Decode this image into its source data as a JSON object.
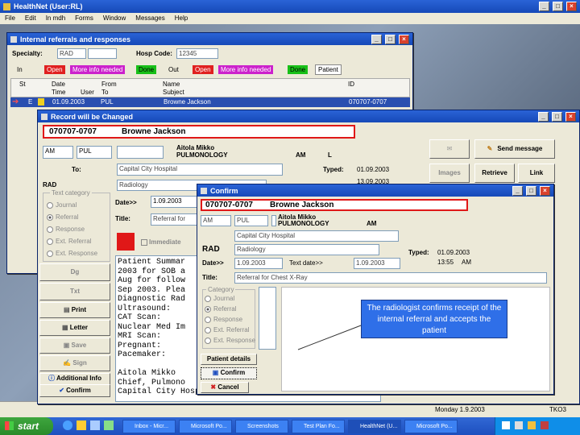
{
  "app": {
    "title": "HealthNet (User:RL)",
    "menu": [
      "File",
      "Edit",
      "In mdh",
      "Forms",
      "Window",
      "Messages",
      "Help"
    ]
  },
  "referrals": {
    "title": "Internal referrals and responses",
    "specialty_label": "Specialty:",
    "specialty_value": "RAD",
    "hosp_label": "Hosp Code:",
    "hosp_value": "12345",
    "in_label": "In",
    "out_label": "Out",
    "tags": [
      "Open",
      "More info needed",
      "Done"
    ],
    "patient_tab": "Patient",
    "headers": {
      "st": "St",
      "date": "Date",
      "time": "Time",
      "user": "User",
      "from": "From",
      "to": "To",
      "name": "Name",
      "subject": "Subject",
      "id": "ID"
    },
    "row": {
      "st": "E",
      "date": "01.09.2003",
      "from": "PUL",
      "name": "Browne Jackson",
      "id": "070707-0707"
    }
  },
  "record": {
    "title": "Record will be Changed",
    "patient_id": "070707-0707",
    "patient_name": "Browne Jackson",
    "am": "AM",
    "pul": "PUL",
    "doctor": "Aitola Mikko",
    "dept": "PULMONOLOGY",
    "am2": "AM",
    "l": "L",
    "to_label": "To:",
    "to_value": "Capital City Hospital",
    "rad": "RAD",
    "radiology": "Radiology",
    "typed_label": "Typed:",
    "typed_value": "01.09.2003",
    "typed_value2": "13.09.2003",
    "category_label": "Text category",
    "categories": [
      "Journal",
      "Referral",
      "Response",
      "Ext. Referral",
      "Ext. Response"
    ],
    "date_label": "Date>>",
    "date_value": "1.09.2003",
    "title_label": "Title:",
    "title_value": "Referral for",
    "immediate": "Immediate",
    "send_message": "Send message",
    "images": "Images",
    "retrieve": "Retrieve",
    "link": "Link",
    "side_buttons": [
      "Dg",
      "Txt",
      "Print",
      "Letter",
      "Save",
      "Sign",
      "Additional Info",
      "Confirm"
    ],
    "body_text": "Patient Summar\n2003 for SOB a\nAug for follow\nSep 2003. Plea\nDiagnostic Rad\nUltrasound:\nCAT Scan:\nNuclear Med Im\nMRI Scan:\nPregnant:\nPacemaker:\n\nAitola Mikko\nChief, Pulmono\nCapital City Hospital/Pulmonology/amc"
  },
  "confirm": {
    "title": "Confirm",
    "patient_id": "070707-0707",
    "patient_name": "Browne Jackson",
    "am": "AM",
    "pul": "PUL",
    "doctor": "Aitola Mikko",
    "dept": "PULMONOLOGY",
    "am2": "AM",
    "hospital": "Capital City Hospital",
    "rad": "RAD",
    "radiology": "Radiology",
    "typed_label": "Typed:",
    "typed_value": "01.09.2003",
    "typed_time": "13:55",
    "typed_ampm": "AM",
    "date_label": "Date>>",
    "date_value": "1.09.2003",
    "text_date_label": "Text date>>",
    "text_date_value": "1.09.2003",
    "title_label": "Title:",
    "title_value": "Referral for Chest X-Ray",
    "category_label": "Category",
    "categories": [
      "Journal",
      "Referral",
      "Response",
      "Ext. Referral",
      "Ext. Response"
    ],
    "patient_details": "Patient details",
    "confirm_btn": "Confirm",
    "cancel_btn": "Cancel"
  },
  "callout": {
    "text": "The  radiologist confirms receipt of the internal referral and accepts the patient"
  },
  "status": {
    "date": "Monday 1.9.2003",
    "code": "TKO3"
  },
  "taskbar": {
    "start": "start",
    "tasks": [
      "Inbox - Micr...",
      "Microsoft Po...",
      "Screenshots",
      "Test Plan Fo...",
      "HealthNet (U...",
      "Microsoft Po..."
    ]
  }
}
